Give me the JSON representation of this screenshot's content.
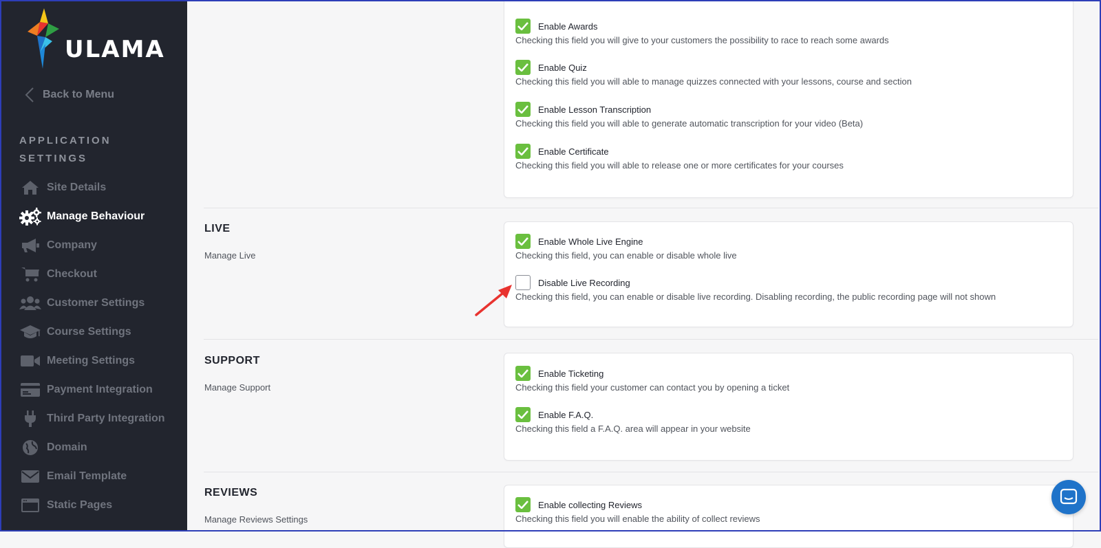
{
  "brand": {
    "name": "ULAMA"
  },
  "sidebar": {
    "back_label": "Back to Menu",
    "section_title": "APPLICATION SETTINGS",
    "items": [
      {
        "label": "Site Details",
        "icon": "home-icon"
      },
      {
        "label": "Manage Behaviour",
        "icon": "gears-icon",
        "active": true
      },
      {
        "label": "Company",
        "icon": "megaphone-icon"
      },
      {
        "label": "Checkout",
        "icon": "cart-icon"
      },
      {
        "label": "Customer Settings",
        "icon": "users-icon"
      },
      {
        "label": "Course Settings",
        "icon": "graduation-cap-icon"
      },
      {
        "label": "Meeting Settings",
        "icon": "video-icon"
      },
      {
        "label": "Payment Integration",
        "icon": "credit-card-icon"
      },
      {
        "label": "Third Party Integration",
        "icon": "plug-icon"
      },
      {
        "label": "Domain",
        "icon": "globe-icon"
      },
      {
        "label": "Email Template",
        "icon": "envelope-icon"
      },
      {
        "label": "Static Pages",
        "icon": "window-icon"
      }
    ]
  },
  "top_card": {
    "options": [
      {
        "label": "Enable Awards",
        "desc": "Checking this field you will give to your customers the possibility to race to reach some awards",
        "checked": true
      },
      {
        "label": "Enable Quiz",
        "desc": "Checking this field you will able to manage quizzes connected with your lessons, course and section",
        "checked": true
      },
      {
        "label": "Enable Lesson Transcription",
        "desc": "Checking this field you will able to generate automatic transcription for your video (Beta)",
        "checked": true
      },
      {
        "label": "Enable Certificate",
        "desc": "Checking this field you will able to release one or more certificates for your courses",
        "checked": true
      }
    ]
  },
  "live": {
    "title": "LIVE",
    "subtitle": "Manage Live",
    "options": [
      {
        "label": "Enable Whole Live Engine",
        "desc": "Checking this field, you can enable or disable whole live",
        "checked": true
      },
      {
        "label": "Disable Live Recording",
        "desc": "Checking this field, you can enable or disable live recording. Disabling recording, the public recording page will not shown",
        "checked": false
      }
    ]
  },
  "support": {
    "title": "SUPPORT",
    "subtitle": "Manage Support",
    "options": [
      {
        "label": "Enable Ticketing",
        "desc": "Checking this field your customer can contact you by opening a ticket",
        "checked": true
      },
      {
        "label": "Enable F.A.Q.",
        "desc": "Checking this field a F.A.Q. area will appear in your website",
        "checked": true
      }
    ]
  },
  "reviews": {
    "title": "REVIEWS",
    "subtitle": "Manage Reviews Settings",
    "options": [
      {
        "label": "Enable collecting Reviews",
        "desc": "Checking this field you will enable the ability of collect reviews",
        "checked": true
      }
    ]
  },
  "colors": {
    "sidebar_bg": "#22252e",
    "check_green": "#6abf3f",
    "chat_blue": "#1f73c9",
    "annotation_red": "#e8332f"
  }
}
